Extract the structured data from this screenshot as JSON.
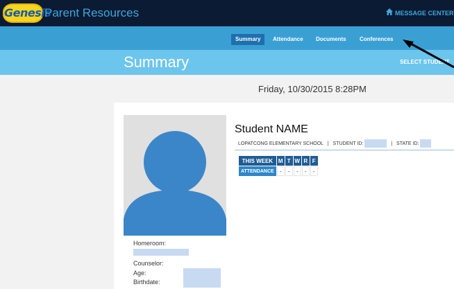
{
  "header": {
    "logo_text": "Genesis",
    "app_title": "Parent Resources",
    "message_center": "MESSAGE CENTER"
  },
  "nav": {
    "items": [
      {
        "label": "Summary",
        "active": true
      },
      {
        "label": "Attendance",
        "active": false
      },
      {
        "label": "Documents",
        "active": false
      },
      {
        "label": "Conferences",
        "active": false
      }
    ]
  },
  "titlebar": {
    "title": "Summary",
    "select_student": "SELECT STUDENT"
  },
  "date": "Friday, 10/30/2015 8:28PM",
  "student": {
    "name": "Student NAME",
    "school": "LOPATCONG ELEMENTARY SCHOOL",
    "student_id_label": "STUDENT ID:",
    "state_id_label": "STATE ID:",
    "sep": "|"
  },
  "attendance": {
    "week_label": "THIS WEEK",
    "row_label": "ATTENDANCE",
    "days": [
      "M",
      "T",
      "W",
      "R",
      "F"
    ],
    "values": [
      "-",
      "-",
      "-",
      "-",
      "-"
    ]
  },
  "info": {
    "homeroom_label": "Homeroom:",
    "counselor_label": "Counselor:",
    "age_label": "Age:",
    "birthdate_label": "Birthdate:"
  },
  "colors": {
    "topbar": "#0b1b33",
    "nav": "#3aa0d4",
    "nav_active": "#1e6fae",
    "titlebar": "#6cc5ec",
    "avatar": "#3b86c8",
    "redaction": "#c7daf2"
  }
}
